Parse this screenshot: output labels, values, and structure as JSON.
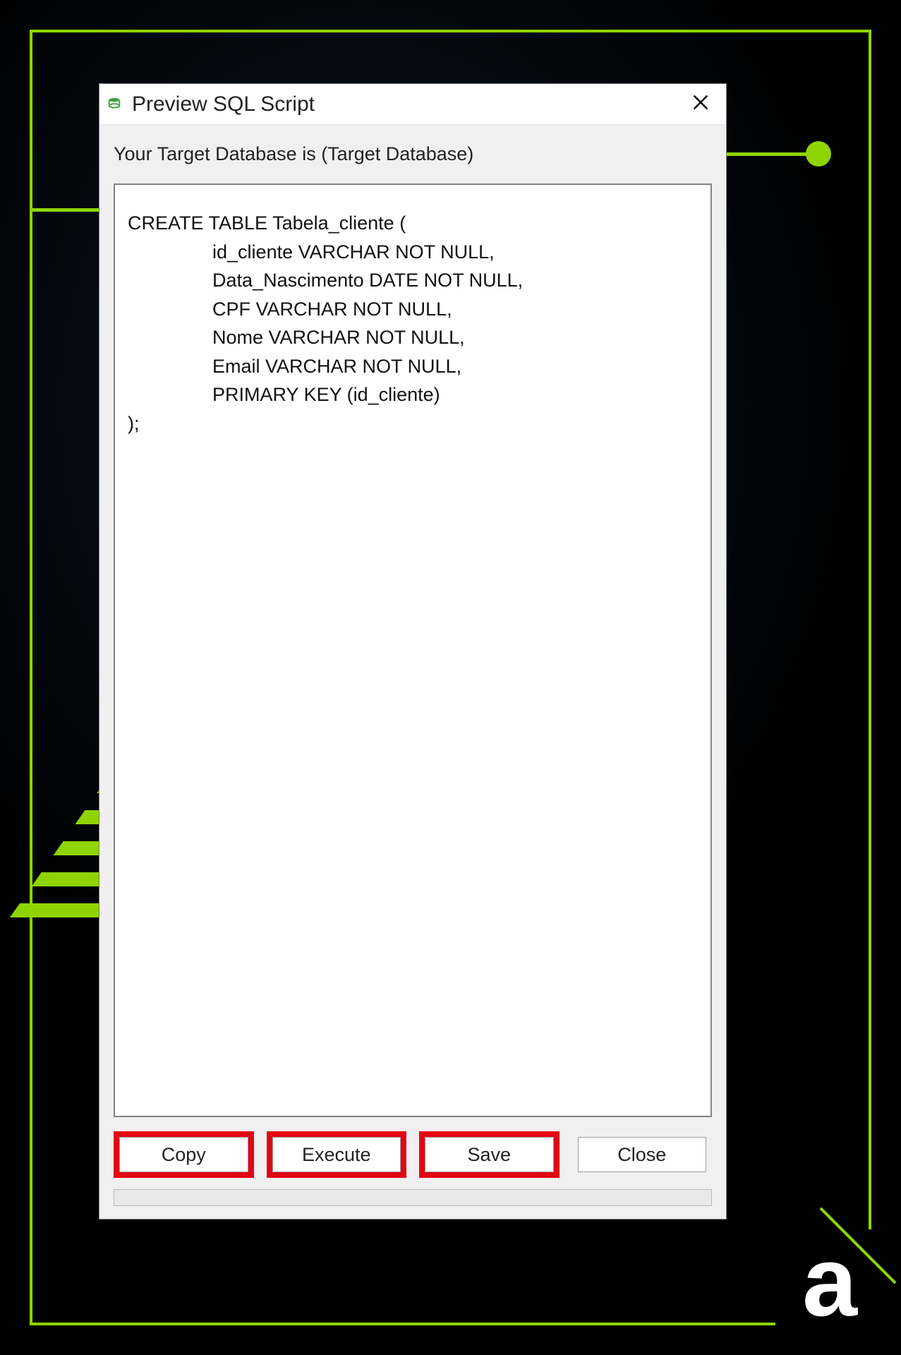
{
  "dialog": {
    "title": "Preview SQL Script",
    "target_label": "Your Target Database is (Target Database)",
    "sql_script": "CREATE TABLE Tabela_cliente (\n                id_cliente VARCHAR NOT NULL,\n                Data_Nascimento DATE NOT NULL,\n                CPF VARCHAR NOT NULL,\n                Nome VARCHAR NOT NULL,\n                Email VARCHAR NOT NULL,\n                PRIMARY KEY (id_cliente)\n);",
    "buttons": {
      "copy": "Copy",
      "execute": "Execute",
      "save": "Save",
      "close": "Close"
    },
    "highlighted_buttons": [
      "copy",
      "execute",
      "save"
    ]
  },
  "decor": {
    "accent_hex": "#8fd400",
    "logo_glyph": "a"
  },
  "icons": {
    "app_icon": "database-app-icon",
    "close_icon": "close-icon"
  }
}
